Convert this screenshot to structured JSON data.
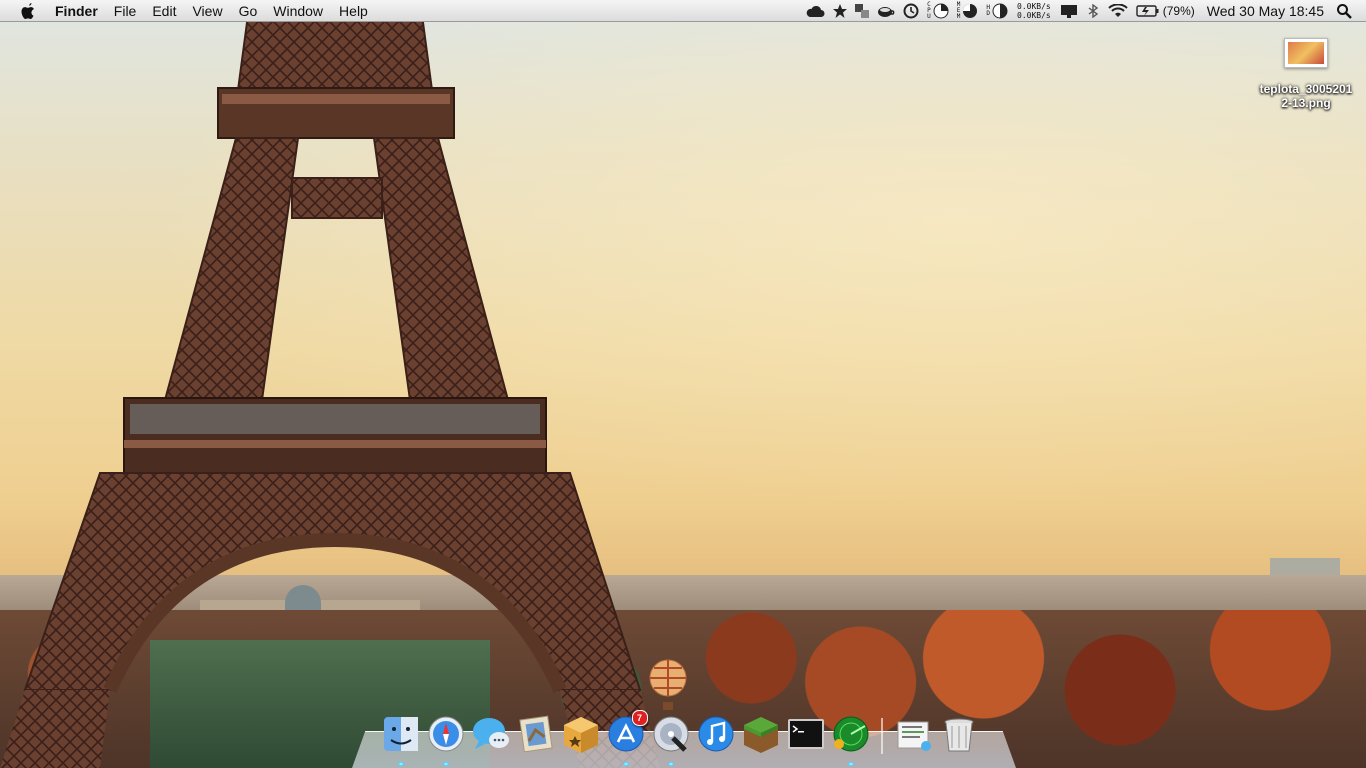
{
  "menubar": {
    "app_name": "Finder",
    "menus": [
      "File",
      "Edit",
      "View",
      "Go",
      "Window",
      "Help"
    ],
    "status_icons": [
      "cloud-icon",
      "star-icon",
      "translate-icon",
      "coffee-icon",
      "time-machine-icon",
      "cpu-icon",
      "memory-icon",
      "disk-icon",
      "network-icon",
      "display-icon",
      "bluetooth-icon",
      "wifi-icon",
      "battery-icon",
      "spotlight-icon"
    ],
    "cpu_label": "CPU",
    "mem_label": "MEM",
    "hd_label": "HD",
    "net_up": "0.0KB/s",
    "net_down": "0.0KB/s",
    "battery_pct": "(79%)",
    "clock": "Wed 30 May  18:45"
  },
  "desktop": {
    "file_name": "teplota_30052012-13.png"
  },
  "dock": {
    "apps": [
      {
        "name": "Finder",
        "icon": "finder-icon"
      },
      {
        "name": "Safari",
        "icon": "safari-icon"
      },
      {
        "name": "Messages",
        "icon": "messages-icon"
      },
      {
        "name": "Mail",
        "icon": "mail-icon"
      },
      {
        "name": "Archive",
        "icon": "box-icon"
      },
      {
        "name": "App Store",
        "icon": "app-store-icon",
        "badge": "7"
      },
      {
        "name": "Disk Utility",
        "icon": "disk-utility-icon"
      },
      {
        "name": "iTunes",
        "icon": "itunes-icon"
      },
      {
        "name": "Minecraft",
        "icon": "minecraft-icon"
      },
      {
        "name": "Terminal",
        "icon": "terminal-icon"
      },
      {
        "name": "Radar",
        "icon": "radar-icon"
      },
      {
        "name": "Documents",
        "icon": "documents-stack-icon"
      },
      {
        "name": "Trash",
        "icon": "trash-icon"
      }
    ]
  },
  "colors": {
    "badge": "#e02020",
    "menubar_top": "#f5f5f5",
    "menubar_bottom": "#dcdcdc"
  }
}
